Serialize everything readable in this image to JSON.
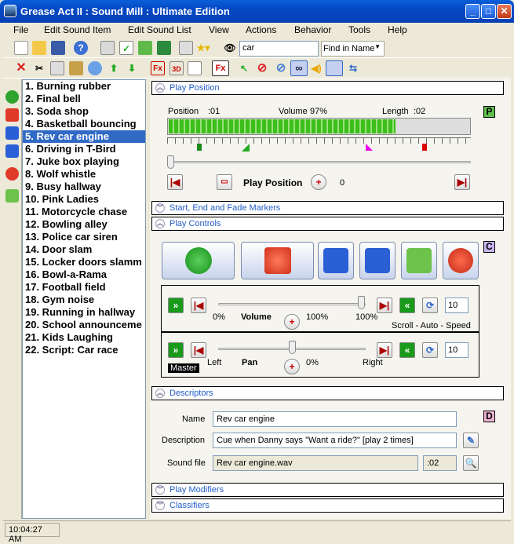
{
  "window": {
    "title": "Grease Act II : Sound Mill : Ultimate Edition"
  },
  "menu": [
    "File",
    "Edit Sound Item",
    "Edit Sound List",
    "View",
    "Actions",
    "Behavior",
    "Tools",
    "Help"
  ],
  "toolbar": {
    "search_value": "car",
    "find_mode": "Find in Name"
  },
  "sound_list": [
    "1. Burning rubber",
    "2. Final bell",
    "3. Soda shop",
    "4. Basketball bouncing",
    "5. Rev car engine",
    "6. Driving in T-Bird",
    "7. Juke box playing",
    "8. Wolf whistle",
    "9. Busy hallway",
    "10. Pink Ladies",
    "11. Motorcycle chase",
    "12. Bowling alley",
    "13. Police car siren",
    "14. Door slam",
    "15. Locker doors slamm",
    "16. Bowl-a-Rama",
    "17. Football field",
    "18. Gym noise",
    "19. Running in hallway",
    "20. School announceme",
    "21. Kids Laughing",
    "22. Script: Car race"
  ],
  "selected_index": 4,
  "sections": {
    "play_position": "Play Position",
    "markers": "Start, End and Fade Markers",
    "play_controls": "Play Controls",
    "descriptors": "Descriptors",
    "play_modifiers": "Play Modifiers",
    "classifiers": "Classifiers"
  },
  "play_position": {
    "position_label": "Position",
    "position_value": ":01",
    "volume_label": "Volume",
    "volume_value": "97%",
    "length_label": "Length",
    "length_value": ":02",
    "meter_fraction": 0.75,
    "title": "Play Position",
    "value": "0",
    "badge": "P"
  },
  "play_controls": {
    "badge": "C",
    "volume": {
      "min": "0%",
      "label": "Volume",
      "mid": "100%",
      "max": "100%",
      "step": "10",
      "level": 0.97
    },
    "scroll_label": "Scroll - Auto - Speed",
    "pan": {
      "left": "Left",
      "label": "Pan",
      "mid": "0%",
      "right": "Right",
      "step": "10",
      "level": 0.5
    },
    "master": "Master"
  },
  "descriptors": {
    "badge": "D",
    "name_label": "Name",
    "name": "Rev car engine",
    "desc_label": "Description",
    "description": "Cue when Danny says \"Want a ride?\" [play 2 times]",
    "file_label": "Sound file",
    "file": "Rev car engine.wav",
    "file_length": ":02"
  },
  "status": {
    "time": "10:04:27 AM"
  }
}
